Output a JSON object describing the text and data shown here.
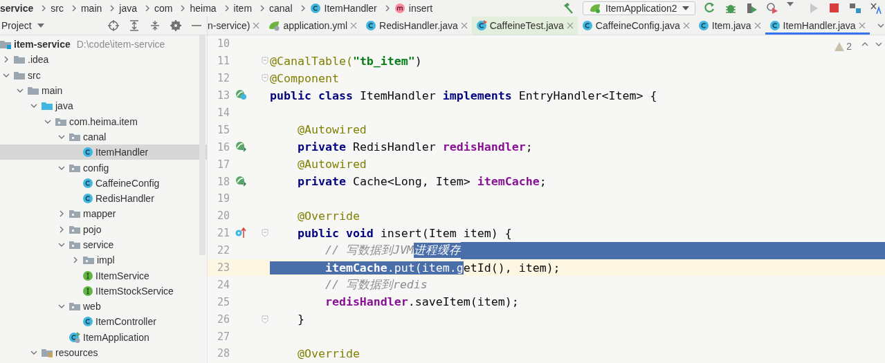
{
  "breadcrumbs": [
    {
      "label": "service",
      "kind": "folder"
    },
    {
      "label": "src",
      "kind": "folder"
    },
    {
      "label": "main",
      "kind": "folder"
    },
    {
      "label": "java",
      "kind": "folder"
    },
    {
      "label": "com",
      "kind": "folder"
    },
    {
      "label": "heima",
      "kind": "folder"
    },
    {
      "label": "item",
      "kind": "folder"
    },
    {
      "label": "canal",
      "kind": "folder"
    },
    {
      "label": "ItemHandler",
      "kind": "class"
    },
    {
      "label": "insert",
      "kind": "method"
    }
  ],
  "run_toolbar": {
    "configuration": "ItemApplication2"
  },
  "project_panel": {
    "title": "Project",
    "tree": [
      {
        "label": "item-service",
        "path": "D:\\code\\item-service",
        "kind": "module",
        "selected": false,
        "children": [
          {
            "label": ".idea",
            "kind": "folder",
            "expanded": false,
            "selected": false
          },
          {
            "label": "src",
            "kind": "folder",
            "expanded": true,
            "selected": false,
            "children": [
              {
                "label": "main",
                "kind": "folder",
                "expanded": true,
                "selected": false,
                "children": [
                  {
                    "label": "java",
                    "kind": "source",
                    "expanded": true,
                    "selected": false,
                    "children": [
                      {
                        "label": "com.heima.item",
                        "kind": "package",
                        "expanded": true,
                        "selected": false,
                        "children": [
                          {
                            "label": "canal",
                            "kind": "package",
                            "expanded": true,
                            "selected": false,
                            "children": [
                              {
                                "label": "ItemHandler",
                                "kind": "class",
                                "selected": true
                              }
                            ]
                          },
                          {
                            "label": "config",
                            "kind": "package",
                            "expanded": true,
                            "selected": false,
                            "children": [
                              {
                                "label": "CaffeineConfig",
                                "kind": "class",
                                "selected": false
                              },
                              {
                                "label": "RedisHandler",
                                "kind": "class",
                                "selected": false
                              }
                            ]
                          },
                          {
                            "label": "mapper",
                            "kind": "package",
                            "expanded": false,
                            "selected": false
                          },
                          {
                            "label": "pojo",
                            "kind": "package",
                            "expanded": false,
                            "selected": false
                          },
                          {
                            "label": "service",
                            "kind": "package",
                            "expanded": true,
                            "selected": false,
                            "children": [
                              {
                                "label": "impl",
                                "kind": "package",
                                "expanded": false,
                                "selected": false
                              },
                              {
                                "label": "IItemService",
                                "kind": "interface",
                                "selected": false
                              },
                              {
                                "label": "IItemStockService",
                                "kind": "interface",
                                "selected": false
                              }
                            ]
                          },
                          {
                            "label": "web",
                            "kind": "package",
                            "expanded": true,
                            "selected": false,
                            "children": [
                              {
                                "label": "ItemController",
                                "kind": "class",
                                "selected": false
                              }
                            ]
                          },
                          {
                            "label": "ItemApplication",
                            "kind": "app",
                            "selected": false
                          }
                        ]
                      }
                    ]
                  },
                  {
                    "label": "resources",
                    "kind": "resources",
                    "expanded": true,
                    "selected": false
                  }
                ]
              }
            ]
          }
        ]
      }
    ]
  },
  "tabs": [
    {
      "label": "n-service)",
      "kind": "plain",
      "selected": false
    },
    {
      "label": "application.yml",
      "kind": "yml",
      "selected": false
    },
    {
      "label": "RedisHandler.java",
      "kind": "class",
      "selected": false
    },
    {
      "label": "CaffeineTest.java",
      "kind": "test",
      "selected": false
    },
    {
      "label": "CaffeineConfig.java",
      "kind": "class",
      "selected": false
    },
    {
      "label": "Item.java",
      "kind": "class",
      "selected": false
    },
    {
      "label": "ItemHandler.java",
      "kind": "class",
      "selected": true
    }
  ],
  "editor": {
    "warnings": "2",
    "lines": [
      {
        "number": "10",
        "fold": false,
        "current": false,
        "selection_to_end": false
      },
      {
        "number": "11",
        "fold": true,
        "current": false,
        "selection_to_end": false,
        "tokens": [
          {
            "text": "@CanalTable(",
            "kind": "annotation",
            "selected": false
          },
          {
            "text": "\"tb_item\"",
            "kind": "string",
            "selected": false
          },
          {
            "text": ")",
            "kind": "plain",
            "selected": false
          }
        ]
      },
      {
        "number": "12",
        "fold": true,
        "current": false,
        "selection_to_end": false,
        "tokens": [
          {
            "text": "@Component",
            "kind": "annotation",
            "selected": false
          }
        ]
      },
      {
        "number": "13",
        "fold": false,
        "current": false,
        "selection_to_end": false,
        "gutter_icon": {
          "kind": "bean"
        },
        "tokens": [
          {
            "text": "public class",
            "kind": "keyword",
            "selected": false
          },
          {
            "text": " ItemHandler ",
            "kind": "plain",
            "selected": false
          },
          {
            "text": "implements",
            "kind": "keyword",
            "selected": false
          },
          {
            "text": " EntryHandler<Item> {",
            "kind": "plain",
            "selected": false
          }
        ]
      },
      {
        "number": "14",
        "fold": false,
        "current": false,
        "selection_to_end": false
      },
      {
        "number": "15",
        "fold": false,
        "current": false,
        "selection_to_end": false,
        "tokens": [
          {
            "text": "    @Autowired",
            "kind": "annotation",
            "selected": false
          }
        ]
      },
      {
        "number": "16",
        "fold": false,
        "current": false,
        "selection_to_end": false,
        "gutter_icon": {
          "kind": "inject"
        },
        "tokens": [
          {
            "text": "    private",
            "kind": "keyword",
            "selected": false
          },
          {
            "text": " RedisHandler ",
            "kind": "plain",
            "selected": false
          },
          {
            "text": "redisHandler",
            "kind": "field",
            "selected": false
          },
          {
            "text": ";",
            "kind": "plain",
            "selected": false
          }
        ]
      },
      {
        "number": "17",
        "fold": false,
        "current": false,
        "selection_to_end": false,
        "tokens": [
          {
            "text": "    @Autowired",
            "kind": "annotation",
            "selected": false
          }
        ]
      },
      {
        "number": "18",
        "fold": false,
        "current": false,
        "selection_to_end": false,
        "gutter_icon": {
          "kind": "inject"
        },
        "tokens": [
          {
            "text": "    private",
            "kind": "keyword",
            "selected": false
          },
          {
            "text": " Cache<Long, Item> ",
            "kind": "plain",
            "selected": false
          },
          {
            "text": "itemCache",
            "kind": "field",
            "selected": false
          },
          {
            "text": ";",
            "kind": "plain",
            "selected": false
          }
        ]
      },
      {
        "number": "19",
        "fold": false,
        "current": false,
        "selection_to_end": false
      },
      {
        "number": "20",
        "fold": false,
        "current": false,
        "selection_to_end": false,
        "tokens": [
          {
            "text": "    @Override",
            "kind": "annotation",
            "selected": false
          }
        ]
      },
      {
        "number": "21",
        "fold": true,
        "current": false,
        "selection_to_end": false,
        "gutter_icon": {
          "kind": "override"
        },
        "tokens": [
          {
            "text": "    public void",
            "kind": "keyword",
            "selected": false
          },
          {
            "text": " insert(Item item) {",
            "kind": "plain",
            "selected": false
          }
        ]
      },
      {
        "number": "22",
        "fold": false,
        "current": false,
        "selection_to_end": true,
        "tokens": [
          {
            "text": "        // 写数据到JVM",
            "kind": "comment",
            "selected": false
          },
          {
            "text": "进程缓存",
            "kind": "comment",
            "selected": true
          }
        ]
      },
      {
        "number": "23",
        "fold": false,
        "current": true,
        "selection_to_end": false,
        "tokens": [
          {
            "text": "        itemCache",
            "kind": "field",
            "selected": true
          },
          {
            "text": ".put(item.g",
            "kind": "plain",
            "selected": true
          },
          {
            "text": "etId(), item);",
            "kind": "plain",
            "selected": false
          }
        ]
      },
      {
        "number": "24",
        "fold": false,
        "current": false,
        "selection_to_end": false,
        "tokens": [
          {
            "text": "        // 写数据到redis",
            "kind": "comment",
            "selected": false
          }
        ]
      },
      {
        "number": "25",
        "fold": false,
        "current": false,
        "selection_to_end": false,
        "tokens": [
          {
            "text": "        redisHandler",
            "kind": "field",
            "selected": false
          },
          {
            "text": ".saveItem(item);",
            "kind": "plain",
            "selected": false
          }
        ]
      },
      {
        "number": "26",
        "fold": true,
        "current": false,
        "selection_to_end": false,
        "tokens": [
          {
            "text": "    }",
            "kind": "plain",
            "selected": false
          }
        ]
      },
      {
        "number": "27",
        "fold": false,
        "current": false,
        "selection_to_end": false
      },
      {
        "number": "28",
        "fold": false,
        "current": false,
        "selection_to_end": false,
        "tokens": [
          {
            "text": "    @Override",
            "kind": "annotation",
            "selected": false
          }
        ]
      }
    ]
  }
}
